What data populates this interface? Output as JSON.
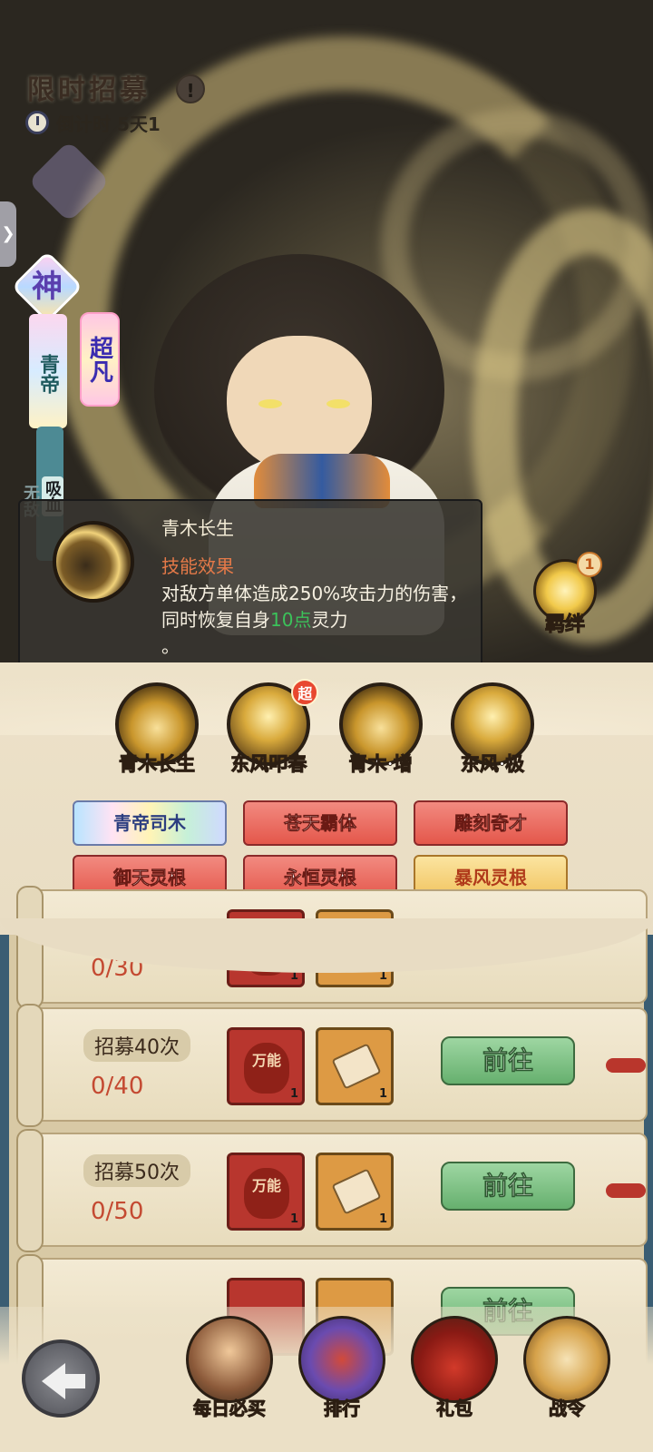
{
  "header": {
    "title": "限时招募",
    "info_icon": "!",
    "countdown": "倒计时 5天1"
  },
  "hero": {
    "god_badge": "神",
    "name": "青帝",
    "rank": "超凡",
    "traits": [
      "吸血",
      "无敌"
    ]
  },
  "skill_tip": {
    "name": "青木长生",
    "effect_heading": "技能效果",
    "desc_part1": "对敌方单体造成250%攻击力的伤害，同时恢复自身",
    "desc_highlight": "10点",
    "desc_part2": "灵力",
    "desc_part3": "。"
  },
  "bond": {
    "label": "羁绊",
    "count": "1"
  },
  "skills": [
    {
      "label": "青木长生"
    },
    {
      "label": "东风叩春",
      "badge": "超"
    },
    {
      "label": "青木·增"
    },
    {
      "label": "东风·极"
    }
  ],
  "talents": [
    "青帝司木",
    "苍天霸体",
    "雕刻奇才",
    "御天灵根",
    "永恒灵根",
    "暴风灵根"
  ],
  "tasks": [
    {
      "progress": "0/30",
      "item1": "万能",
      "qty1": "1",
      "qty2": "1"
    },
    {
      "title": "招募40次",
      "progress": "0/40",
      "item1": "万能",
      "qty1": "1",
      "qty2": "1",
      "button": "前往"
    },
    {
      "title": "招募50次",
      "progress": "0/50",
      "item1": "万能",
      "qty1": "1",
      "qty2": "1",
      "button": "前往"
    },
    {
      "button": "前往"
    }
  ],
  "bottom_nav": [
    {
      "label": "每日必买"
    },
    {
      "label": "排行"
    },
    {
      "label": "礼包"
    },
    {
      "label": "战令"
    }
  ],
  "colors": {
    "highlight_green": "#3bc25a",
    "effect_orange": "#e47948",
    "progress_red": "#c44a32"
  }
}
